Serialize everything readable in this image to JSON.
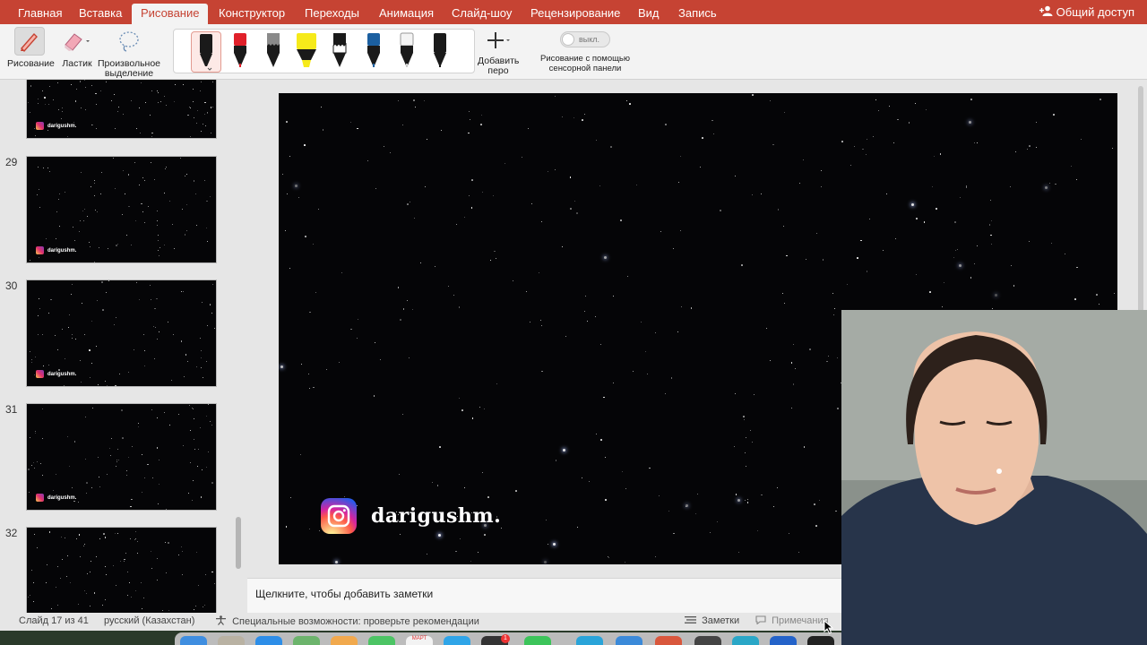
{
  "ribbon": {
    "tabs": [
      "Главная",
      "Вставка",
      "Рисование",
      "Конструктор",
      "Переходы",
      "Анимация",
      "Слайд-шоу",
      "Рецензирование",
      "Вид",
      "Запись"
    ],
    "active_tab": "Рисование",
    "share_label": "Общий доступ",
    "tools": {
      "draw": "Рисование",
      "eraser": "Ластик",
      "lasso_line1": "Произвольное",
      "lasso_line2": "выделение",
      "add_pen_line1": "Добавить",
      "add_pen_line2": "перо",
      "touch_toggle": "выкл.",
      "touch_label_line1": "Рисование с помощью",
      "touch_label_line2": "сенсорной панели"
    },
    "pens": [
      {
        "color": "#1a1a1a",
        "type": "pen",
        "selected": true
      },
      {
        "color": "#e0202a",
        "type": "pen"
      },
      {
        "color": "#808080",
        "type": "pencil"
      },
      {
        "color": "#f6ea1a",
        "type": "highlighter"
      },
      {
        "color": "#1a1a1a",
        "type": "pencil"
      },
      {
        "color": "#1b5fa0",
        "type": "pen"
      },
      {
        "color": "#f4f4f4",
        "type": "pen"
      },
      {
        "color": "#1a1a1a",
        "type": "pen"
      }
    ]
  },
  "thumbnails": [
    {
      "number": "",
      "brand": "darigushm."
    },
    {
      "number": "29",
      "brand": "darigushm."
    },
    {
      "number": "30",
      "brand": "darigushm."
    },
    {
      "number": "31",
      "brand": "darigushm."
    },
    {
      "number": "32",
      "brand": ""
    }
  ],
  "slide": {
    "brand_name": "darigushm."
  },
  "notes": {
    "placeholder": "Щелкните, чтобы добавить заметки"
  },
  "status": {
    "slide_count": "Слайд 17 из 41",
    "language": "русский (Казахстан)",
    "accessibility": "Специальные возможности: проверьте рекомендации",
    "notes_button": "Заметки",
    "comments_button": "Примечания"
  },
  "dock": {
    "calendar_label": "МАРТ",
    "badge": "1"
  },
  "colors": {
    "ribbon_accent": "#c64333",
    "slide_background": "#050507"
  }
}
